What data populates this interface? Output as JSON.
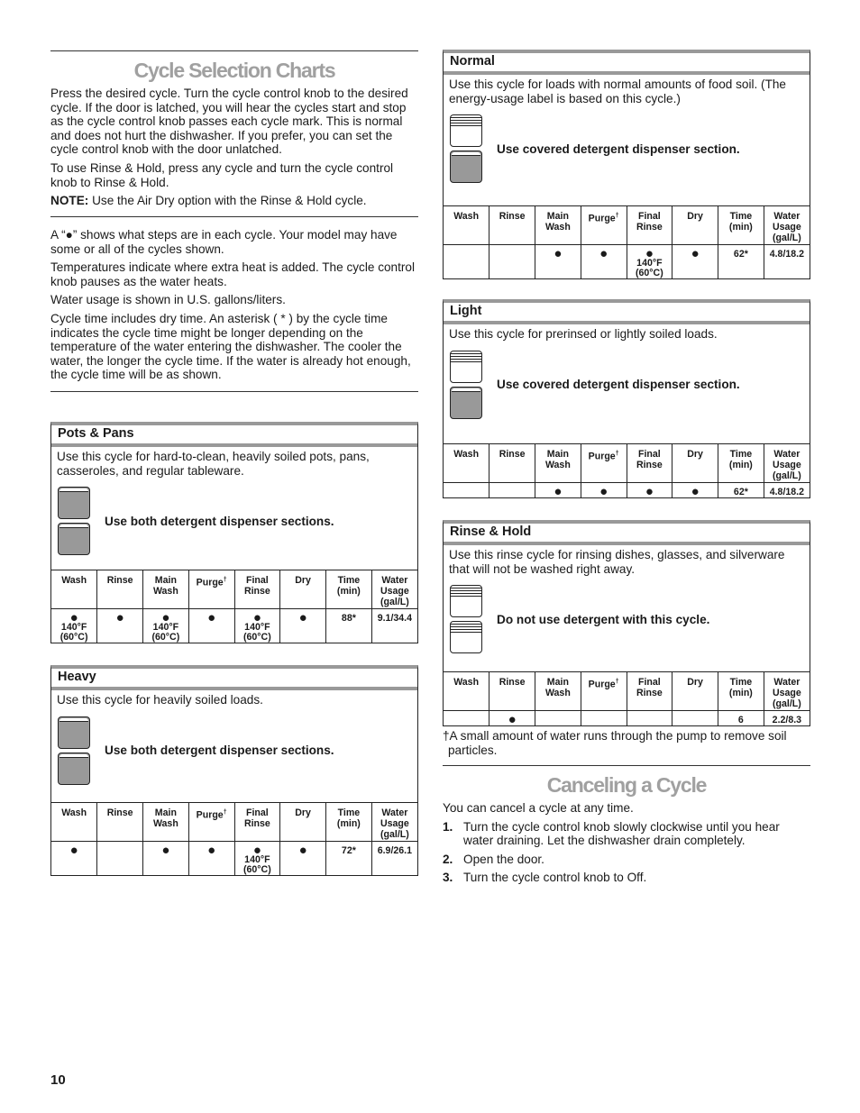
{
  "title": "Cycle Selection Charts",
  "intro": [
    "Press the desired cycle. Turn the cycle control knob to the desired cycle. If the door is latched, you will hear the cycles start and stop as the cycle control knob passes each cycle mark. This is normal and does not hurt the dishwasher. If you prefer, you can set the cycle control knob with the door unlatched.",
    "To use Rinse & Hold, press any cycle and turn the cycle control knob to Rinse & Hold."
  ],
  "note": {
    "label": "NOTE:",
    "text": " Use the Air Dry option with the Rinse & Hold cycle."
  },
  "legend": [
    "A “●” shows what steps are in each cycle. Your model may have some or all of the cycles shown.",
    "Temperatures indicate where extra heat is added. The cycle control knob pauses as the water heats.",
    "Water usage is shown in U.S. gallons/liters.",
    "Cycle time includes dry time. An asterisk ( * ) by the cycle time indicates the cycle time might be longer depending on the temperature of the water entering the dishwasher. The cooler the water, the longer the cycle time. If the water is already hot enough, the cycle time will be as shown."
  ],
  "columns": [
    "Wash",
    "Rinse",
    "Main Wash",
    "Purge†",
    "Final Rinse",
    "Dry",
    "Time (min)",
    "Water Usage (gal/L)"
  ],
  "temp": "140°F (60°C)",
  "cycles": [
    {
      "name": "Pots & Pans",
      "desc": "Use this cycle for hard-to-clean, heavily soiled pots, pans, casseroles, and regular tableware.",
      "icon_label": "Use both detergent dispenser sections.",
      "icons": [
        "dispenser-filled-icon",
        "dispenser-filled-icon"
      ],
      "steps": {
        "wash": "● 140°F (60°C)",
        "rinse": "●",
        "main_wash": "● 140°F (60°C)",
        "purge": "●",
        "final_rinse": "● 140°F (60°C)",
        "dry": "●",
        "time": "88*",
        "water": "9.1/34.4"
      }
    },
    {
      "name": "Heavy",
      "desc": "Use this cycle for heavily soiled loads.",
      "icon_label": "Use both detergent dispenser sections.",
      "icons": [
        "dispenser-filled-icon",
        "dispenser-filled-icon"
      ],
      "steps": {
        "wash": "●",
        "rinse": "",
        "main_wash": "●",
        "purge": "●",
        "final_rinse": "● 140°F (60°C)",
        "dry": "●",
        "time": "72*",
        "water": "6.9/26.1"
      }
    },
    {
      "name": "Normal",
      "desc": "Use this cycle for loads with normal amounts of food soil. (The energy-usage label is based on this cycle.)",
      "icon_label": "Use covered detergent dispenser section.",
      "icons": [
        "dispenser-empty-icon",
        "dispenser-filled-icon"
      ],
      "steps": {
        "wash": "",
        "rinse": "",
        "main_wash": "●",
        "purge": "●",
        "final_rinse": "● 140°F (60°C)",
        "dry": "●",
        "time": "62*",
        "water": "4.8/18.2"
      }
    },
    {
      "name": "Light",
      "desc": "Use this cycle for prerinsed or lightly soiled loads.",
      "icon_label": "Use covered detergent dispenser section.",
      "icons": [
        "dispenser-empty-icon",
        "dispenser-filled-icon"
      ],
      "steps": {
        "wash": "",
        "rinse": "",
        "main_wash": "●",
        "purge": "●",
        "final_rinse": "●",
        "dry": "●",
        "time": "62*",
        "water": "4.8/18.2"
      }
    },
    {
      "name": "Rinse & Hold",
      "desc": "Use this rinse cycle for rinsing dishes, glasses, and silverware that will not be washed right away.",
      "icon_label": "Do not use detergent with this cycle.",
      "icons": [
        "dispenser-empty-icon",
        "dispenser-empty-icon"
      ],
      "steps": {
        "wash": "",
        "rinse": "●",
        "main_wash": "",
        "purge": "",
        "final_rinse": "",
        "dry": "",
        "time": "6",
        "water": "2.2/8.3"
      }
    }
  ],
  "footnote": "†A small amount of water runs through the pump to remove soil particles.",
  "cancel": {
    "title": "Canceling a Cycle",
    "intro": "You can cancel a cycle at any time.",
    "steps": [
      {
        "num": "1.",
        "text": "Turn the cycle control knob slowly clockwise until you hear water draining. Let the dishwasher drain completely."
      },
      {
        "num": "2.",
        "text": "Open the door."
      },
      {
        "num": "3.",
        "text": "Turn the cycle control knob to Off."
      }
    ]
  },
  "page_number": "10"
}
